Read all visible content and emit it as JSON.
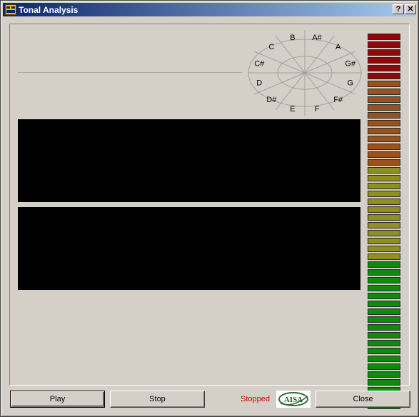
{
  "window": {
    "title": "Tonal Analysis",
    "help_glyph": "?",
    "close_glyph": "✕"
  },
  "pitch_wheel": {
    "notes": [
      "A#",
      "A",
      "G#",
      "G",
      "F#",
      "F",
      "E",
      "D#",
      "D",
      "C#",
      "C",
      "B"
    ]
  },
  "level_meter": {
    "segments": 48,
    "colors": {
      "green": "#0f8a0f",
      "olive": "#8f8f1f",
      "orange": "#9a521a",
      "red": "#8b0a0a"
    },
    "bands": [
      {
        "color": "green",
        "count": 19
      },
      {
        "color": "olive",
        "count": 12
      },
      {
        "color": "orange",
        "count": 11
      },
      {
        "color": "red",
        "count": 6
      }
    ]
  },
  "controls": {
    "play_label": "Play",
    "stop_label": "Stop",
    "status_text": "Stopped",
    "close_label": "Close",
    "logo_text": "AISA"
  },
  "colors": {
    "status": "#d00000",
    "display_bg": "#000000",
    "title_start": "#0a246a",
    "title_end": "#a6caf0"
  }
}
